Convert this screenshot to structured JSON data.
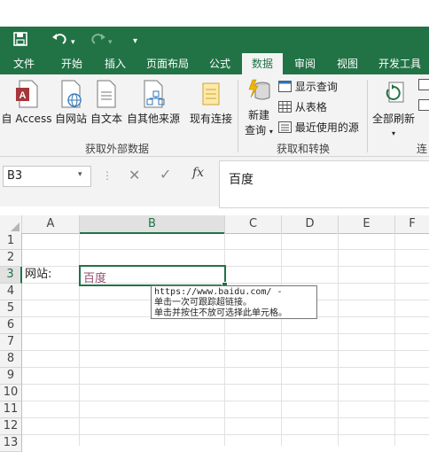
{
  "quick_access": {
    "save": "save-icon",
    "undo": "undo-icon",
    "redo": "redo-icon",
    "customize": "customize-icon"
  },
  "tabs": [
    "文件",
    "开始",
    "插入",
    "页面布局",
    "公式",
    "数据",
    "审阅",
    "视图",
    "开发工具"
  ],
  "active_tab": "数据",
  "ribbon": {
    "external": {
      "access": "自 Access",
      "web": "自网站",
      "text": "自文本",
      "other": "自其他来源",
      "existing": "现有连接",
      "group_label": "获取外部数据"
    },
    "transform": {
      "new_query_1": "新建",
      "new_query_2": "查询",
      "show_query": "显示查询",
      "from_table": "从表格",
      "recent_sources": "最近使用的源",
      "group_label": "获取和转换"
    },
    "refresh": {
      "label": "全部刷新",
      "group_label_partial": "连"
    }
  },
  "formula_bar": {
    "name_box": "B3",
    "fx": "fx",
    "content": "百度"
  },
  "sheet": {
    "columns": [
      "A",
      "B",
      "C",
      "D",
      "E",
      "F"
    ],
    "rows": [
      "1",
      "2",
      "3",
      "4",
      "5",
      "6",
      "7",
      "8",
      "9",
      "10",
      "11",
      "12",
      "13"
    ],
    "a3": "网站:",
    "b3": "百度"
  },
  "tooltip": {
    "line1": "https://www.baidu.com/ -",
    "line2": "单击一次可跟踪超链接。",
    "line3": "单击并按住不放可选择此单元格。"
  },
  "colors": {
    "excel_green": "#217346",
    "hyperlink": "#954f72"
  }
}
